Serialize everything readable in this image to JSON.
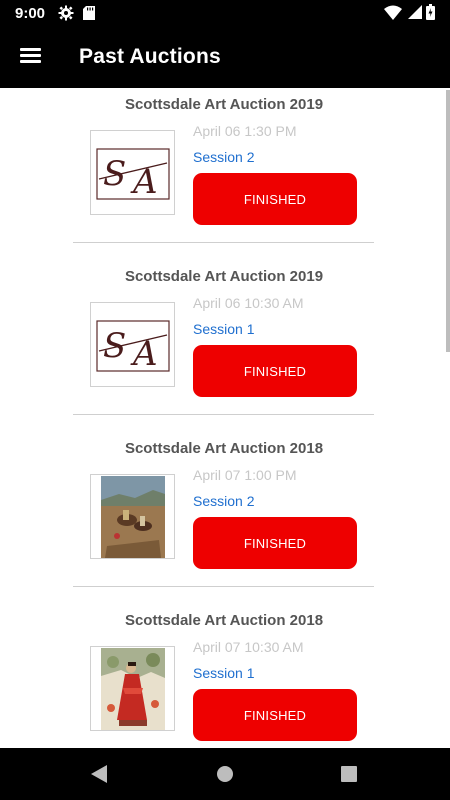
{
  "status_bar": {
    "time": "9:00"
  },
  "app_bar": {
    "title": "Past Auctions"
  },
  "auctions": [
    {
      "title": "Scottsdale Art Auction 2019",
      "date": "April 06 1:30 PM",
      "session": "Session 2",
      "status": "FINISHED",
      "thumbnail": "sa-logo"
    },
    {
      "title": "Scottsdale Art Auction 2019",
      "date": "April 06 10:30 AM",
      "session": "Session 1",
      "status": "FINISHED",
      "thumbnail": "sa-logo"
    },
    {
      "title": "Scottsdale Art Auction 2018",
      "date": "April 07 1:00 PM",
      "session": "Session 2",
      "status": "FINISHED",
      "thumbnail": "painting-western-riders"
    },
    {
      "title": "Scottsdale Art Auction 2018",
      "date": "April 07 10:30 AM",
      "session": "Session 1",
      "status": "FINISHED",
      "thumbnail": "painting-woman-red-dress"
    }
  ],
  "colors": {
    "accent_red": "#ee0000",
    "session_blue": "#1f6fcf",
    "date_gray": "#c7c7c7"
  }
}
